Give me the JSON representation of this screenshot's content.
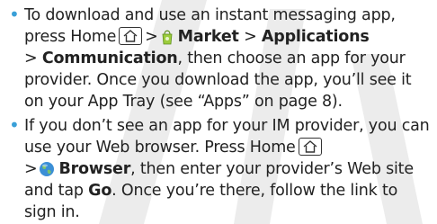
{
  "colors": {
    "bullet": "#3aa0d8",
    "text": "#222222",
    "watermark": "#ececec"
  },
  "bullets": [
    {
      "lines": {
        "l1": "To download and use an instant messaging app,",
        "l2a": "press Home",
        "l2b": ">",
        "l2c": "Market",
        "l2d": ">",
        "l2e": "Applications",
        "l3a": ">",
        "l3b": "Communication",
        "l3c": ", then choose an app for your",
        "l4": "provider. Once you download the app, you’ll see it",
        "l5": "on your App Tray (see “Apps” on page 8)."
      }
    },
    {
      "lines": {
        "l1": "If you don’t see an app for your IM provider, you can",
        "l2": "use your Web browser. Press Home",
        "l3a": ">",
        "l3b": "Browser",
        "l3c": ", then enter your provider’s Web site",
        "l4a": "and tap",
        "l4b": "Go",
        "l4c": ". Once you’re there, follow the link to",
        "l5": "sign in."
      }
    }
  ],
  "icons": [
    "home-key-icon",
    "market-icon",
    "browser-icon",
    "draft-watermark"
  ]
}
